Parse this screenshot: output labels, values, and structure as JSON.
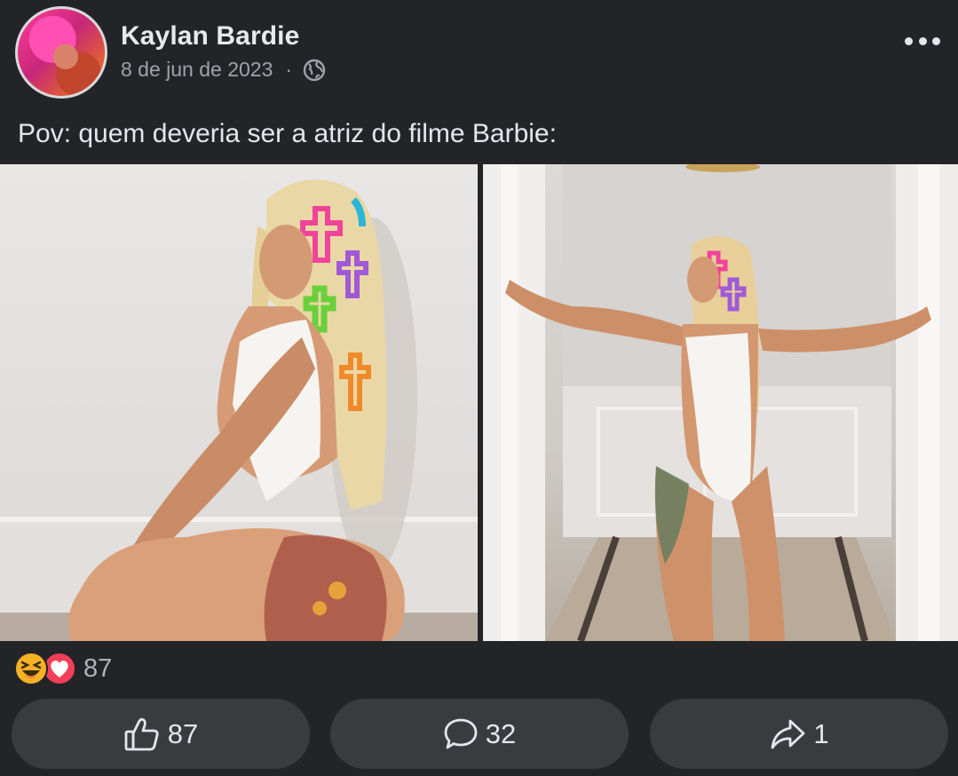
{
  "post": {
    "author_name": "Kaylan Bardie",
    "date": "8 de jun de 2023",
    "separator": "·",
    "privacy_icon": "globe-icon",
    "more_icon": "more-horizontal-icon",
    "caption": "Pov: quem deveria ser a atriz do filme Barbie:"
  },
  "reactions": {
    "icons": [
      "haha-reaction-icon",
      "love-reaction-icon"
    ],
    "count": "87"
  },
  "actions": {
    "like_count": "87",
    "comment_count": "32",
    "share_count": "1"
  },
  "colors": {
    "background": "#232427",
    "button_bg": "#3a3b3f",
    "text_primary": "#e4e6eb",
    "text_secondary": "#9fa2a8",
    "love_red": "#f33e58",
    "haha_yellow": "#f7b125"
  }
}
